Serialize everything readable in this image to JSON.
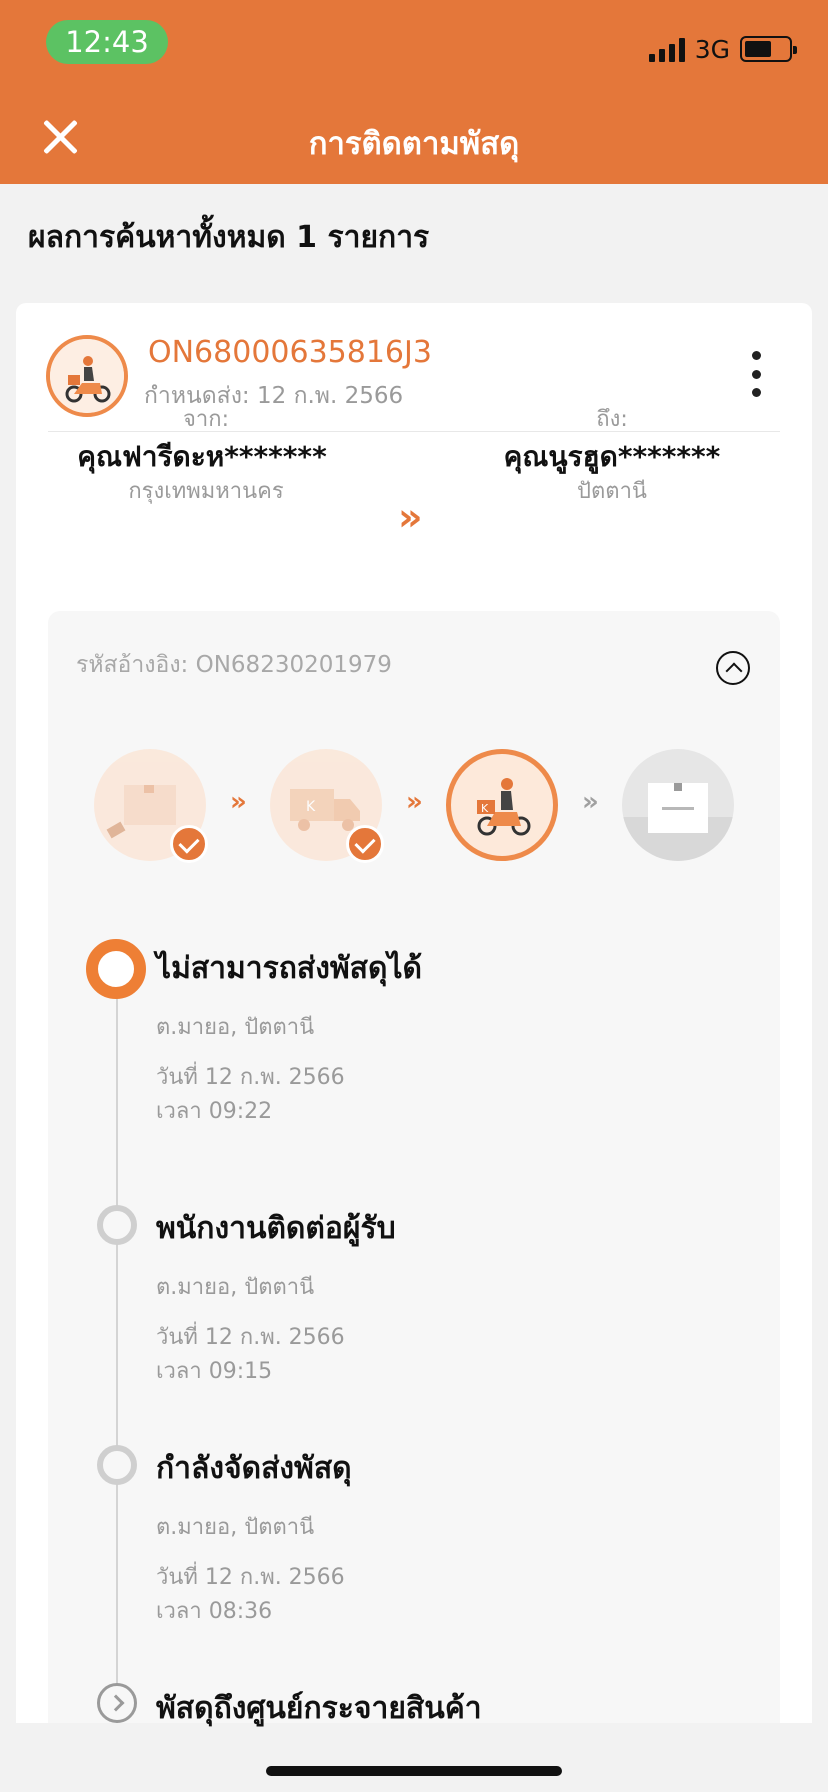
{
  "status_bar": {
    "time": "12:43",
    "network": "3G"
  },
  "header": {
    "title": "การติดตามพัสดุ"
  },
  "results": {
    "count_text": "ผลการค้นหาทั้งหมด 1 รายการ"
  },
  "parcel": {
    "tracking_number": "ON68000635816J3",
    "due_text": "กำหนดส่ง: 12 ก.พ. 2566",
    "from_label": "จาก:",
    "from_name": "คุณฟารีดะห*******",
    "from_city": "กรุงเทพมหานคร",
    "to_label": "ถึง:",
    "to_name": "คุณนูรฮูด*******",
    "to_city": "ปัตตานี",
    "route_arrow": "»"
  },
  "detail": {
    "reference": "รหัสอ้างอิง: ON68230201979"
  },
  "progress_steps": [
    {
      "icon": "parcel-box-icon",
      "state": "done"
    },
    {
      "icon": "delivery-truck-icon",
      "state": "done"
    },
    {
      "icon": "delivery-scooter-icon",
      "state": "active"
    },
    {
      "icon": "delivered-box-icon",
      "state": "pending"
    }
  ],
  "timeline": [
    {
      "title": "ไม่สามารถส่งพัสดุได้",
      "location": "ต.มายอ, ปัตตานี",
      "date": "วันที่ 12 ก.พ. 2566",
      "time": "เวลา 09:22"
    },
    {
      "title": "พนักงานติดต่อผู้รับ",
      "location": "ต.มายอ, ปัตตานี",
      "date": "วันที่ 12 ก.พ. 2566",
      "time": "เวลา 09:15"
    },
    {
      "title": "กำลังจัดส่งพัสดุ",
      "location": "ต.มายอ, ปัตตานี",
      "date": "วันที่ 12 ก.พ. 2566",
      "time": "เวลา 08:36"
    },
    {
      "title": "พัสดุถึงศูนย์กระจายสินค้า"
    }
  ],
  "colors": {
    "brand": "#e4773a",
    "status_pill": "#5cc263"
  }
}
